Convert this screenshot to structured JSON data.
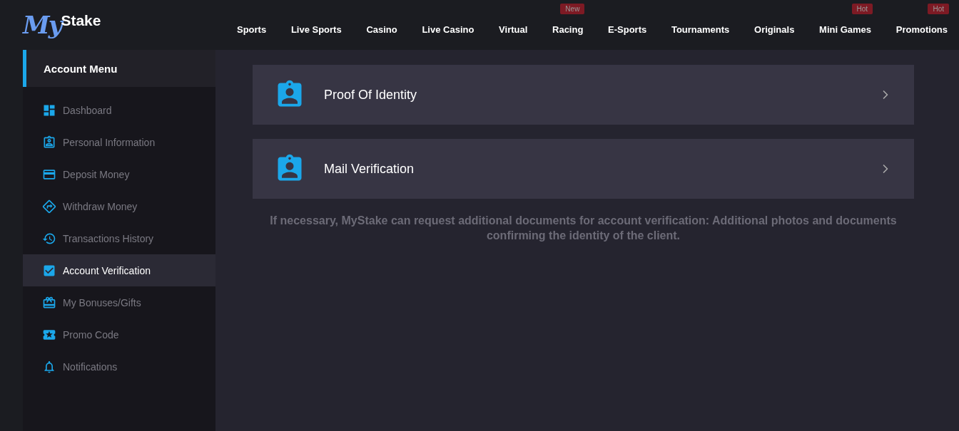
{
  "logo": {
    "script": "My",
    "word": "Stake"
  },
  "nav": [
    {
      "label": "Sports"
    },
    {
      "label": "Live Sports"
    },
    {
      "label": "Casino"
    },
    {
      "label": "Live Casino"
    },
    {
      "label": "Virtual"
    },
    {
      "label": "Racing",
      "badge": "New"
    },
    {
      "label": "E-Sports"
    },
    {
      "label": "Tournaments"
    },
    {
      "label": "Originals"
    },
    {
      "label": "Mini Games",
      "badge": "Hot"
    },
    {
      "label": "Promotions",
      "badge": "Hot"
    }
  ],
  "sidebar": {
    "title": "Account Menu",
    "items": [
      {
        "label": "Dashboard",
        "kind": "dashboard",
        "selected": false
      },
      {
        "label": "Personal Information",
        "kind": "badge",
        "selected": false
      },
      {
        "label": "Deposit Money",
        "kind": "card",
        "selected": false
      },
      {
        "label": "Withdraw Money",
        "kind": "direction",
        "selected": false
      },
      {
        "label": "Transactions History",
        "kind": "history",
        "selected": false
      },
      {
        "label": "Account Verification",
        "kind": "check",
        "selected": true
      },
      {
        "label": "My Bonuses/Gifts",
        "kind": "gift",
        "selected": false
      },
      {
        "label": "Promo Code",
        "kind": "ticket",
        "selected": false
      },
      {
        "label": "Notifications",
        "kind": "bell",
        "selected": false
      }
    ]
  },
  "verification_items": [
    {
      "label": "Proof Of Identity"
    },
    {
      "label": "Mail Verification"
    }
  ],
  "note": "If necessary, MyStake can request additional documents for account verification: Additional photos and documents confirming the identity of the client."
}
